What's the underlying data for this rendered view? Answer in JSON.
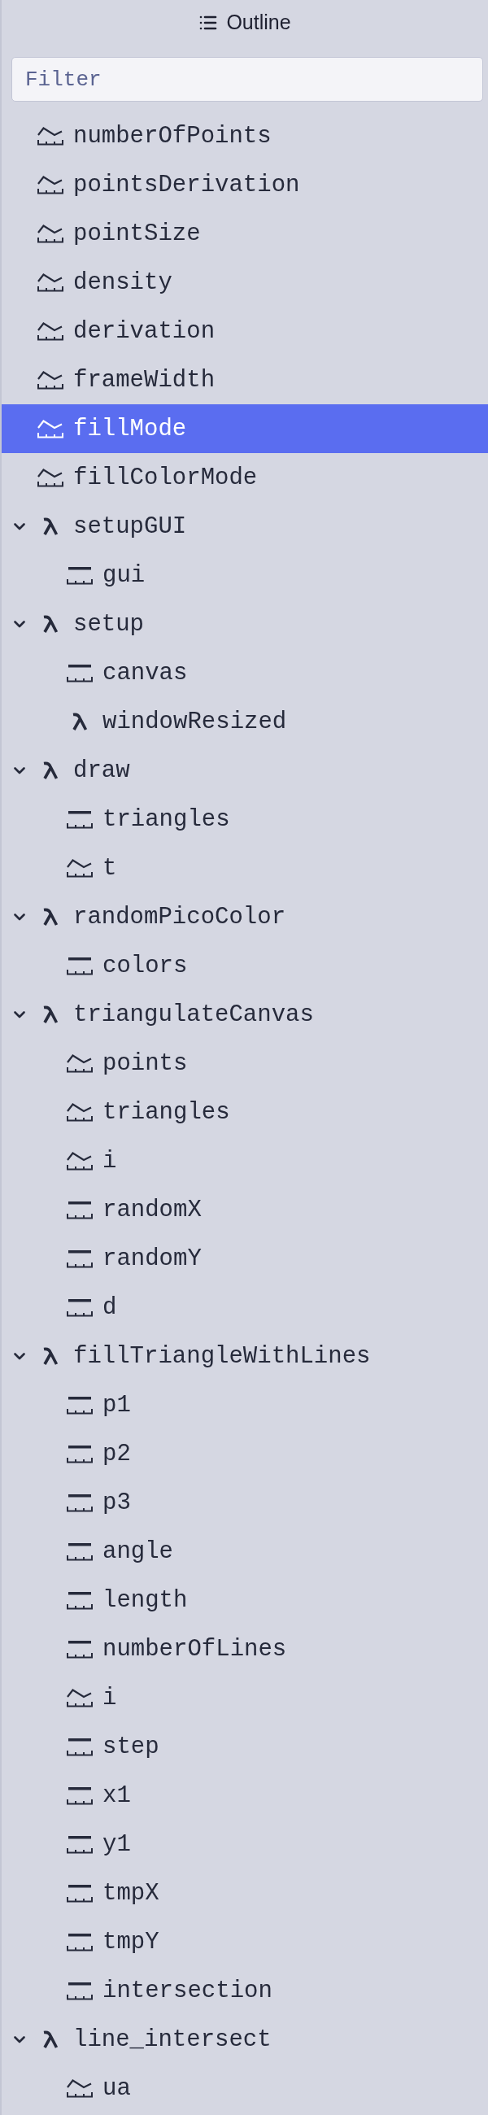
{
  "header": {
    "title": "Outline"
  },
  "filter": {
    "placeholder": "Filter"
  },
  "outline": [
    {
      "label": "numberOfPoints",
      "kind": "variable",
      "selected": false
    },
    {
      "label": "pointsDerivation",
      "kind": "variable",
      "selected": false
    },
    {
      "label": "pointSize",
      "kind": "variable",
      "selected": false
    },
    {
      "label": "density",
      "kind": "variable",
      "selected": false
    },
    {
      "label": "derivation",
      "kind": "variable",
      "selected": false
    },
    {
      "label": "frameWidth",
      "kind": "variable",
      "selected": false
    },
    {
      "label": "fillMode",
      "kind": "variable",
      "selected": true
    },
    {
      "label": "fillColorMode",
      "kind": "variable",
      "selected": false
    },
    {
      "label": "setupGUI",
      "kind": "function",
      "selected": false,
      "expanded": true,
      "children": [
        {
          "label": "gui",
          "kind": "constant",
          "selected": false
        }
      ]
    },
    {
      "label": "setup",
      "kind": "function",
      "selected": false,
      "expanded": true,
      "children": [
        {
          "label": "canvas",
          "kind": "constant",
          "selected": false
        },
        {
          "label": "windowResized",
          "kind": "function",
          "selected": false
        }
      ]
    },
    {
      "label": "draw",
      "kind": "function",
      "selected": false,
      "expanded": true,
      "children": [
        {
          "label": "triangles",
          "kind": "constant",
          "selected": false
        },
        {
          "label": "t",
          "kind": "variable",
          "selected": false
        }
      ]
    },
    {
      "label": "randomPicoColor",
      "kind": "function",
      "selected": false,
      "expanded": true,
      "children": [
        {
          "label": "colors",
          "kind": "constant",
          "selected": false
        }
      ]
    },
    {
      "label": "triangulateCanvas",
      "kind": "function",
      "selected": false,
      "expanded": true,
      "children": [
        {
          "label": "points",
          "kind": "variable",
          "selected": false
        },
        {
          "label": "triangles",
          "kind": "variable",
          "selected": false
        },
        {
          "label": "i",
          "kind": "variable",
          "selected": false
        },
        {
          "label": "randomX",
          "kind": "constant",
          "selected": false
        },
        {
          "label": "randomY",
          "kind": "constant",
          "selected": false
        },
        {
          "label": "d",
          "kind": "constant",
          "selected": false
        }
      ]
    },
    {
      "label": "fillTriangleWithLines",
      "kind": "function",
      "selected": false,
      "expanded": true,
      "children": [
        {
          "label": "p1",
          "kind": "constant",
          "selected": false
        },
        {
          "label": "p2",
          "kind": "constant",
          "selected": false
        },
        {
          "label": "p3",
          "kind": "constant",
          "selected": false
        },
        {
          "label": "angle",
          "kind": "constant",
          "selected": false
        },
        {
          "label": "length",
          "kind": "constant",
          "selected": false
        },
        {
          "label": "numberOfLines",
          "kind": "constant",
          "selected": false
        },
        {
          "label": "i",
          "kind": "variable",
          "selected": false
        },
        {
          "label": "step",
          "kind": "constant",
          "selected": false
        },
        {
          "label": "x1",
          "kind": "constant",
          "selected": false
        },
        {
          "label": "y1",
          "kind": "constant",
          "selected": false
        },
        {
          "label": "tmpX",
          "kind": "constant",
          "selected": false
        },
        {
          "label": "tmpY",
          "kind": "constant",
          "selected": false
        },
        {
          "label": "intersection",
          "kind": "constant",
          "selected": false
        }
      ]
    },
    {
      "label": "line_intersect",
      "kind": "function",
      "selected": false,
      "expanded": true,
      "children": [
        {
          "label": "ua",
          "kind": "variable",
          "selected": false
        }
      ]
    }
  ]
}
